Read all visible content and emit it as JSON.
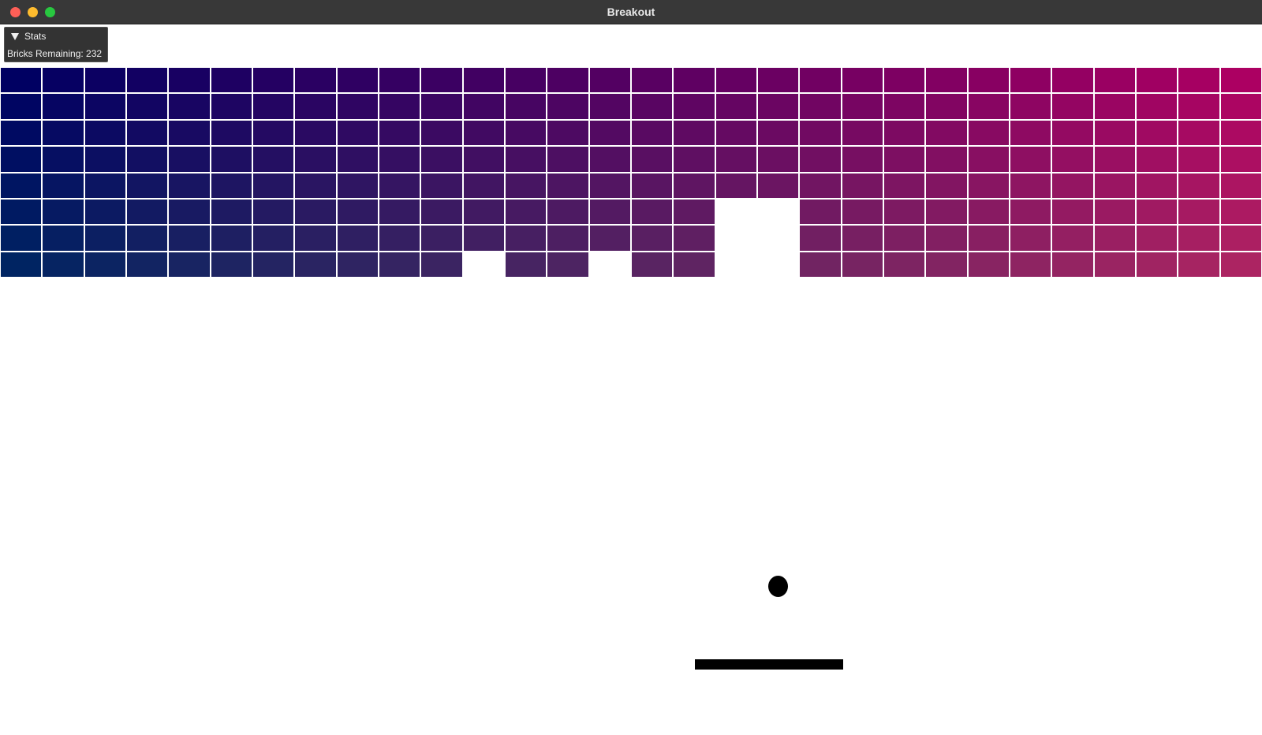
{
  "window": {
    "title": "Breakout"
  },
  "stats": {
    "header": "Stats",
    "bricks_remaining_label": "Bricks Remaining:",
    "bricks_remaining_value": "232"
  },
  "board": {
    "cols": 30,
    "rows": 8,
    "gradient": {
      "top_left": "#000062",
      "top_right": "#ac0062",
      "bottom_left": "#002462",
      "bottom_right": "#ac2462"
    },
    "missing_bricks": [
      [
        5,
        17
      ],
      [
        5,
        18
      ],
      [
        6,
        17
      ],
      [
        6,
        18
      ],
      [
        7,
        11
      ],
      [
        7,
        14
      ],
      [
        7,
        17
      ],
      [
        7,
        18
      ]
    ],
    "ball_color": "#000000",
    "paddle_color": "#000000"
  }
}
